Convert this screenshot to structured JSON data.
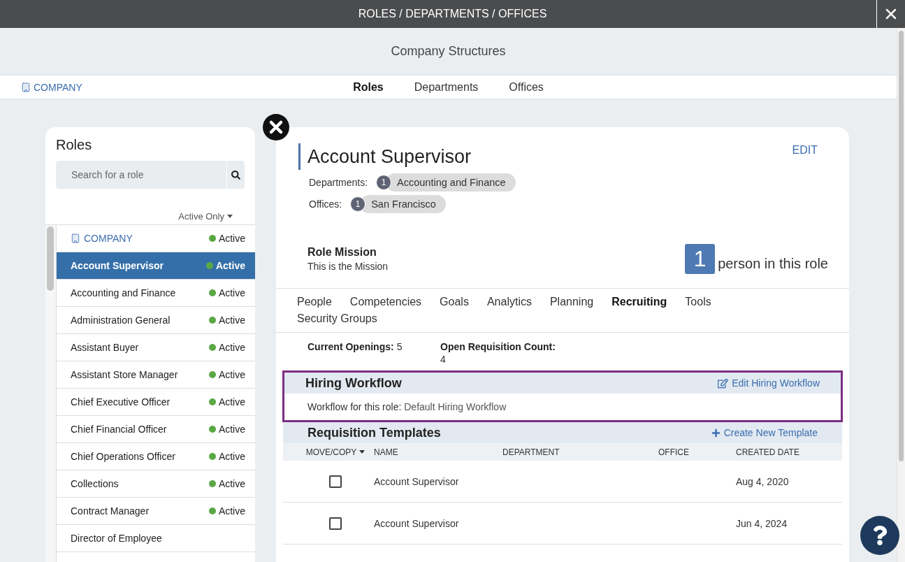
{
  "window": {
    "title": "ROLES / DEPARTMENTS / OFFICES"
  },
  "header": {
    "title": "Company Structures"
  },
  "nav": {
    "company_link": "COMPANY",
    "tabs": [
      {
        "label": "Roles",
        "selected": true
      },
      {
        "label": "Departments",
        "selected": false
      },
      {
        "label": "Offices",
        "selected": false
      }
    ]
  },
  "roles_panel": {
    "title": "Roles",
    "search": {
      "placeholder": "Search for a role"
    },
    "filter": "Active Only",
    "items": [
      {
        "kind": "company",
        "name": "COMPANY",
        "status": "Active",
        "selected": false
      },
      {
        "kind": "role",
        "name": "Account Supervisor",
        "status": "Active",
        "selected": true
      },
      {
        "kind": "role",
        "name": "Accounting and Finance",
        "status": "Active",
        "selected": false
      },
      {
        "kind": "role",
        "name": "Administration General",
        "status": "Active",
        "selected": false
      },
      {
        "kind": "role",
        "name": "Assistant Buyer",
        "status": "Active",
        "selected": false
      },
      {
        "kind": "role",
        "name": "Assistant Store Manager",
        "status": "Active",
        "selected": false
      },
      {
        "kind": "role",
        "name": "Chief Executive Officer",
        "status": "Active",
        "selected": false
      },
      {
        "kind": "role",
        "name": "Chief Financial Officer",
        "status": "Active",
        "selected": false
      },
      {
        "kind": "role",
        "name": "Chief Operations Officer",
        "status": "Active",
        "selected": false
      },
      {
        "kind": "role",
        "name": "Collections",
        "status": "Active",
        "selected": false
      },
      {
        "kind": "role",
        "name": "Contract Manager",
        "status": "Active",
        "selected": false
      },
      {
        "kind": "role",
        "name": "Director of Employee",
        "selected": false
      }
    ]
  },
  "role": {
    "title": "Account Supervisor",
    "edit": "EDIT",
    "departments_label": "Departments:",
    "departments": [
      {
        "count": "1",
        "name": "Accounting and Finance"
      }
    ],
    "offices_label": "Offices:",
    "offices": [
      {
        "count": "1",
        "name": "San Francisco"
      }
    ],
    "mission_label": "Role Mission",
    "mission": "This is the Mission",
    "people_count": "1",
    "people_label": "person in this role"
  },
  "role_tabs": [
    {
      "label": "People",
      "selected": false
    },
    {
      "label": "Competencies",
      "selected": false
    },
    {
      "label": "Goals",
      "selected": false
    },
    {
      "label": "Analytics",
      "selected": false
    },
    {
      "label": "Planning",
      "selected": false
    },
    {
      "label": "Recruiting",
      "selected": true
    },
    {
      "label": "Tools",
      "selected": false
    },
    {
      "label": "Security Groups",
      "selected": false
    }
  ],
  "stats": [
    {
      "label": "Current Openings:",
      "value": "5"
    },
    {
      "label": "Open Requisition Count:",
      "value": "4"
    }
  ],
  "hiring_workflow": {
    "highlighted": true,
    "title": "Hiring Workflow",
    "edit_link": "Edit Hiring Workflow",
    "label": "Workflow for this role:",
    "value": "Default Hiring Workflow"
  },
  "requisition_templates": {
    "title": "Requisition Templates",
    "create_link": "Create New Template",
    "columns": [
      {
        "label": "MOVE/COPY",
        "dropdown": true
      },
      {
        "label": "NAME",
        "dropdown": false
      },
      {
        "label": "DEPARTMENT",
        "dropdown": false
      },
      {
        "label": "OFFICE",
        "dropdown": false
      },
      {
        "label": "CREATED DATE",
        "dropdown": false
      }
    ],
    "rows": [
      {
        "checked": false,
        "name": "Account Supervisor",
        "created_date": "Aug 4, 2020"
      },
      {
        "checked": false,
        "name": "Account Supervisor",
        "created_date": "Jun 4, 2024"
      }
    ]
  }
}
